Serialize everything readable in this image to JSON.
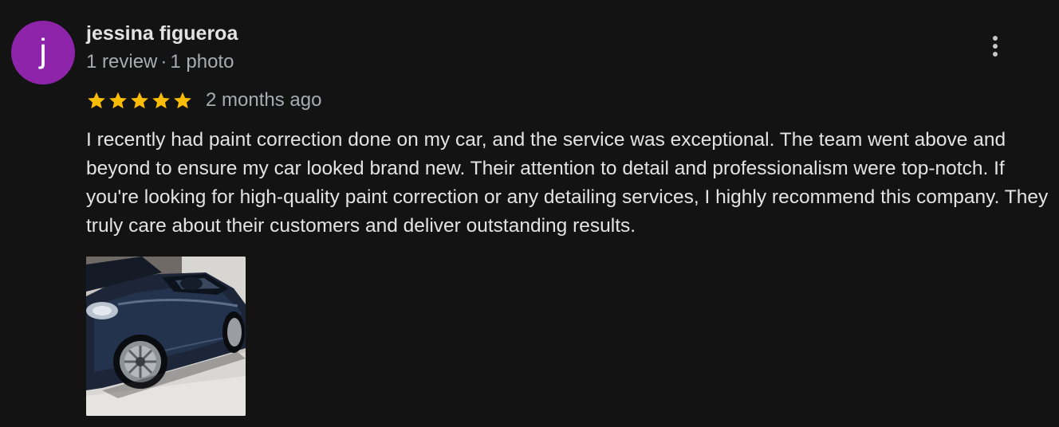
{
  "review": {
    "author": {
      "initial": "j",
      "name": "jessina figueroa",
      "review_count": "1 review",
      "separator": "·",
      "photo_count": "1 photo",
      "avatar_color": "#8e24aa"
    },
    "rating": 5,
    "time_ago": "2 months ago",
    "text": "I recently had paint correction done on my car, and the service was exceptional. The team went above and beyond to ensure my car looked brand new. Their attention to detail and professionalism were top-notch. If you're looking for high-quality paint correction or any detailing services, I highly recommend this company. They truly care about their customers and deliver outstanding results.",
    "photos": [
      {
        "subject": "dark blue car"
      }
    ],
    "more_options_icon": "more-vert-icon"
  },
  "colors": {
    "background": "#131314",
    "star": "#fbbc04",
    "text": "#e3e3e3",
    "secondary_text": "#a8abb0"
  }
}
